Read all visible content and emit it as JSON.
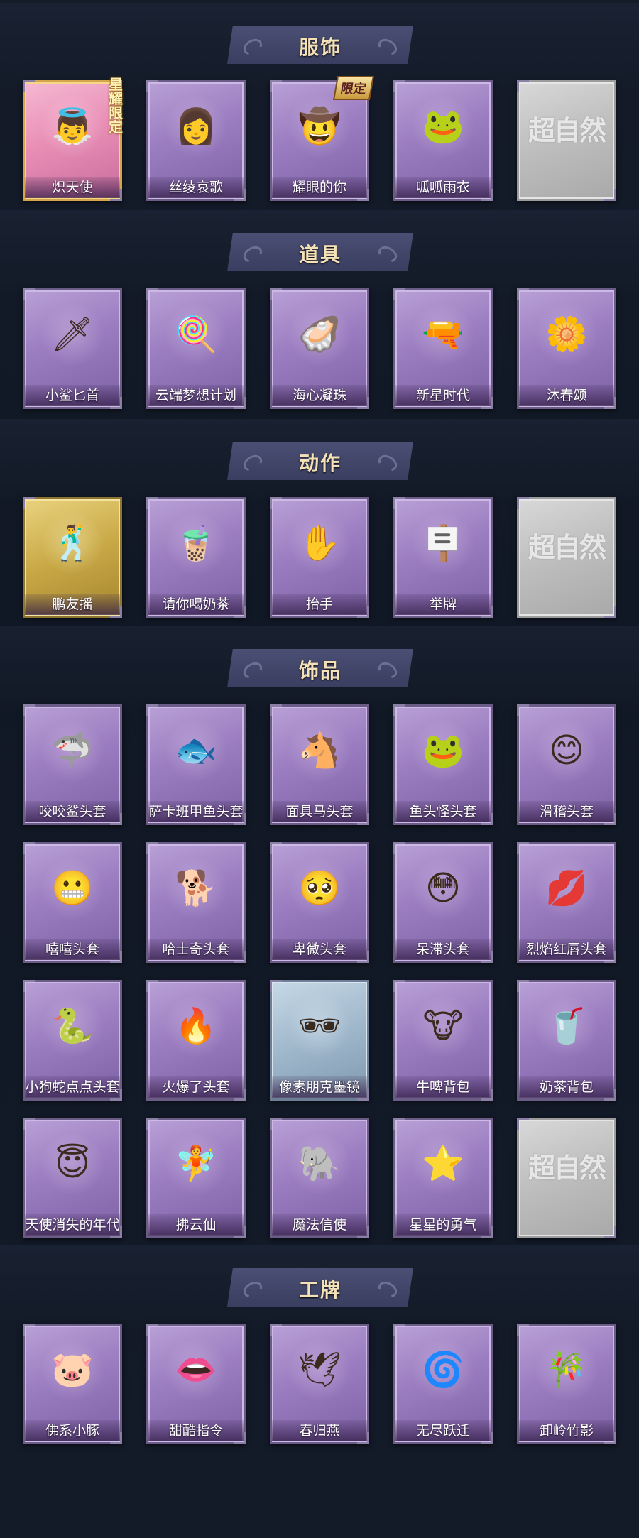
{
  "sections": [
    {
      "title": "服饰",
      "items": [
        {
          "name": "炽天使",
          "style": "pink",
          "badge": "星耀限定",
          "icon": "angel-portrait-icon",
          "glyph": "👼"
        },
        {
          "name": "丝绫哀歌",
          "style": "purple",
          "icon": "lady-portrait-icon",
          "glyph": "👩"
        },
        {
          "name": "耀眼的你",
          "style": "purple",
          "badge": "限定",
          "icon": "cowgirl-portrait-icon",
          "glyph": "🤠"
        },
        {
          "name": "呱呱雨衣",
          "style": "purple",
          "icon": "frog-girl-portrait-icon",
          "glyph": "🐸"
        },
        {
          "name": "",
          "style": "placeholder",
          "logo": "超自然",
          "icon": "placeholder-logo-icon"
        }
      ]
    },
    {
      "title": "道具",
      "items": [
        {
          "name": "小鲨匕首",
          "style": "purple",
          "icon": "shark-dagger-icon",
          "glyph": "🗡"
        },
        {
          "name": "云端梦想计划",
          "style": "purple",
          "icon": "dream-mace-icon",
          "glyph": "🍭"
        },
        {
          "name": "海心凝珠",
          "style": "purple",
          "icon": "pearl-shell-icon",
          "glyph": "🦪"
        },
        {
          "name": "新星时代",
          "style": "purple",
          "icon": "revolver-icon",
          "glyph": "🔫"
        },
        {
          "name": "沐春颂",
          "style": "purple",
          "icon": "flower-umbrella-icon",
          "glyph": "🌼"
        }
      ]
    },
    {
      "title": "动作",
      "items": [
        {
          "name": "鹏友摇",
          "style": "gold",
          "icon": "dance-pose-icon",
          "glyph": "🕺"
        },
        {
          "name": "请你喝奶茶",
          "style": "purple",
          "icon": "milk-tea-pose-icon",
          "glyph": "🧋"
        },
        {
          "name": "抬手",
          "style": "purple",
          "icon": "raise-hand-icon",
          "glyph": "✋"
        },
        {
          "name": "举牌",
          "style": "purple",
          "icon": "hold-sign-icon",
          "glyph": "🪧"
        },
        {
          "name": "",
          "style": "placeholder",
          "logo": "超自然",
          "icon": "placeholder-logo-icon"
        }
      ]
    },
    {
      "title": "饰品",
      "items": [
        {
          "name": "咬咬鲨头套",
          "style": "purple",
          "icon": "shark-head-icon",
          "glyph": "🦈"
        },
        {
          "name": "萨卡班甲鱼头套",
          "style": "purple",
          "icon": "fish-head-icon",
          "glyph": "🐟"
        },
        {
          "name": "面具马头套",
          "style": "purple",
          "icon": "horse-head-icon",
          "glyph": "🐴"
        },
        {
          "name": "鱼头怪头套",
          "style": "purple",
          "icon": "fish-monster-head-icon",
          "glyph": "🐸"
        },
        {
          "name": "滑稽头套",
          "style": "purple",
          "icon": "smirk-face-icon",
          "glyph": "😊"
        },
        {
          "name": "嘻嘻头套",
          "style": "purple",
          "icon": "grin-face-icon",
          "glyph": "😬"
        },
        {
          "name": "哈士奇头套",
          "style": "purple",
          "icon": "husky-head-icon",
          "glyph": "🐕"
        },
        {
          "name": "卑微头套",
          "style": "purple",
          "icon": "humble-face-icon",
          "glyph": "🥺"
        },
        {
          "name": "呆滞头套",
          "style": "purple",
          "icon": "dazed-face-icon",
          "glyph": "😳"
        },
        {
          "name": "烈焰红唇头套",
          "style": "purple",
          "icon": "red-lips-head-icon",
          "glyph": "💋"
        },
        {
          "name": "小狗蛇点点头套",
          "style": "purple",
          "icon": "snake-head-icon",
          "glyph": "🐍"
        },
        {
          "name": "火爆了头套",
          "style": "purple",
          "icon": "fire-head-icon",
          "glyph": "🔥"
        },
        {
          "name": "像素朋克墨镜",
          "style": "blue",
          "icon": "pixel-sunglasses-icon",
          "glyph": "🕶"
        },
        {
          "name": "牛啤背包",
          "style": "purple",
          "icon": "cow-beer-backpack-icon",
          "glyph": "🐮"
        },
        {
          "name": "奶茶背包",
          "style": "purple",
          "icon": "milk-tea-backpack-icon",
          "glyph": "🥤"
        },
        {
          "name": "天使消失的年代",
          "style": "purple",
          "icon": "angel-charm-icon",
          "glyph": "😇"
        },
        {
          "name": "拂云仙",
          "style": "purple",
          "icon": "cloud-fairy-charm-icon",
          "glyph": "🧚"
        },
        {
          "name": "魔法信使",
          "style": "purple",
          "icon": "elephant-charm-icon",
          "glyph": "🐘"
        },
        {
          "name": "星星的勇气",
          "style": "purple",
          "icon": "star-charm-icon",
          "glyph": "⭐"
        },
        {
          "name": "",
          "style": "placeholder",
          "logo": "超自然",
          "icon": "placeholder-logo-icon"
        }
      ]
    },
    {
      "title": "工牌",
      "items": [
        {
          "name": "佛系小豚",
          "style": "purple",
          "icon": "piglet-badge-icon",
          "glyph": "🐷"
        },
        {
          "name": "甜酷指令",
          "style": "purple",
          "icon": "pink-mouth-badge-icon",
          "glyph": "👄"
        },
        {
          "name": "春归燕",
          "style": "purple",
          "icon": "swallow-badge-icon",
          "glyph": "🕊"
        },
        {
          "name": "无尽跃迁",
          "style": "purple",
          "icon": "warp-badge-icon",
          "glyph": "🌀"
        },
        {
          "name": "卸岭竹影",
          "style": "purple",
          "icon": "bamboo-badge-icon",
          "glyph": "🎋"
        }
      ]
    }
  ]
}
